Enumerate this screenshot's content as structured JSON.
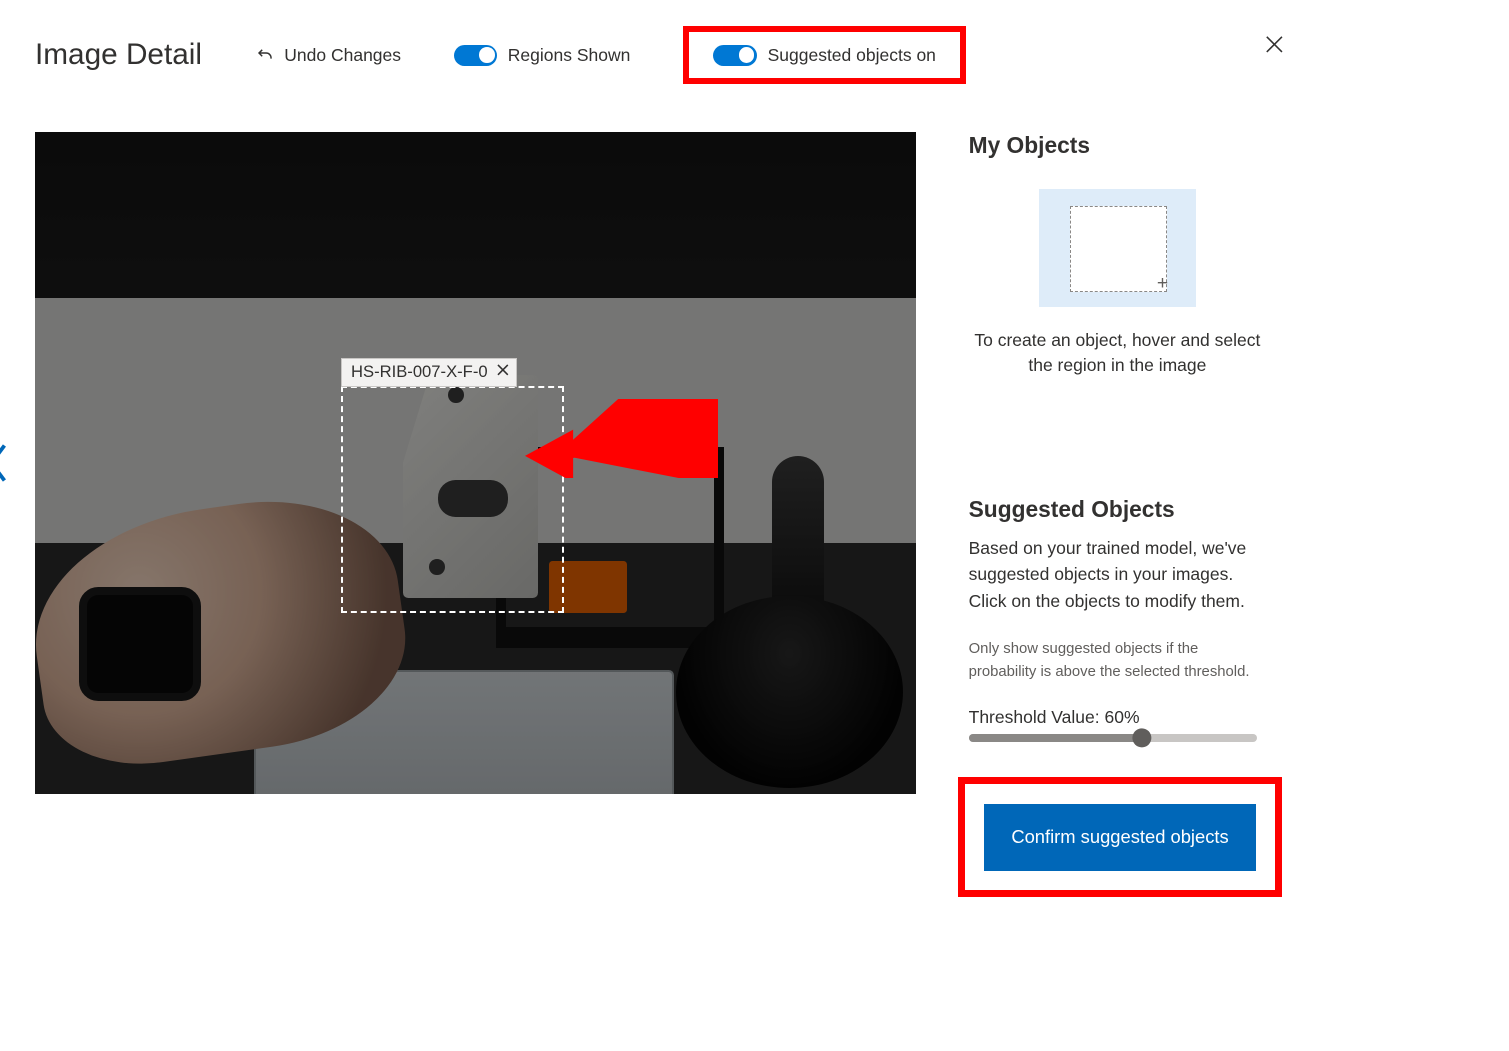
{
  "header": {
    "title": "Image Detail",
    "undo_label": "Undo Changes",
    "regions_toggle_label": "Regions Shown",
    "suggested_toggle_label": "Suggested objects on"
  },
  "region": {
    "label": "HS-RIB-007-X-F-0"
  },
  "side": {
    "my_objects_heading": "My Objects",
    "create_hint": "To create an object, hover and select the region in the image",
    "suggested_heading": "Suggested Objects",
    "suggested_desc": "Based on your trained model, we've suggested objects in your images. Click on the objects to modify them.",
    "threshold_note": "Only show suggested objects if the probability is above the selected threshold.",
    "threshold_label": "Threshold Value: 60%",
    "threshold_value": 60,
    "confirm_label": "Confirm suggested objects"
  }
}
